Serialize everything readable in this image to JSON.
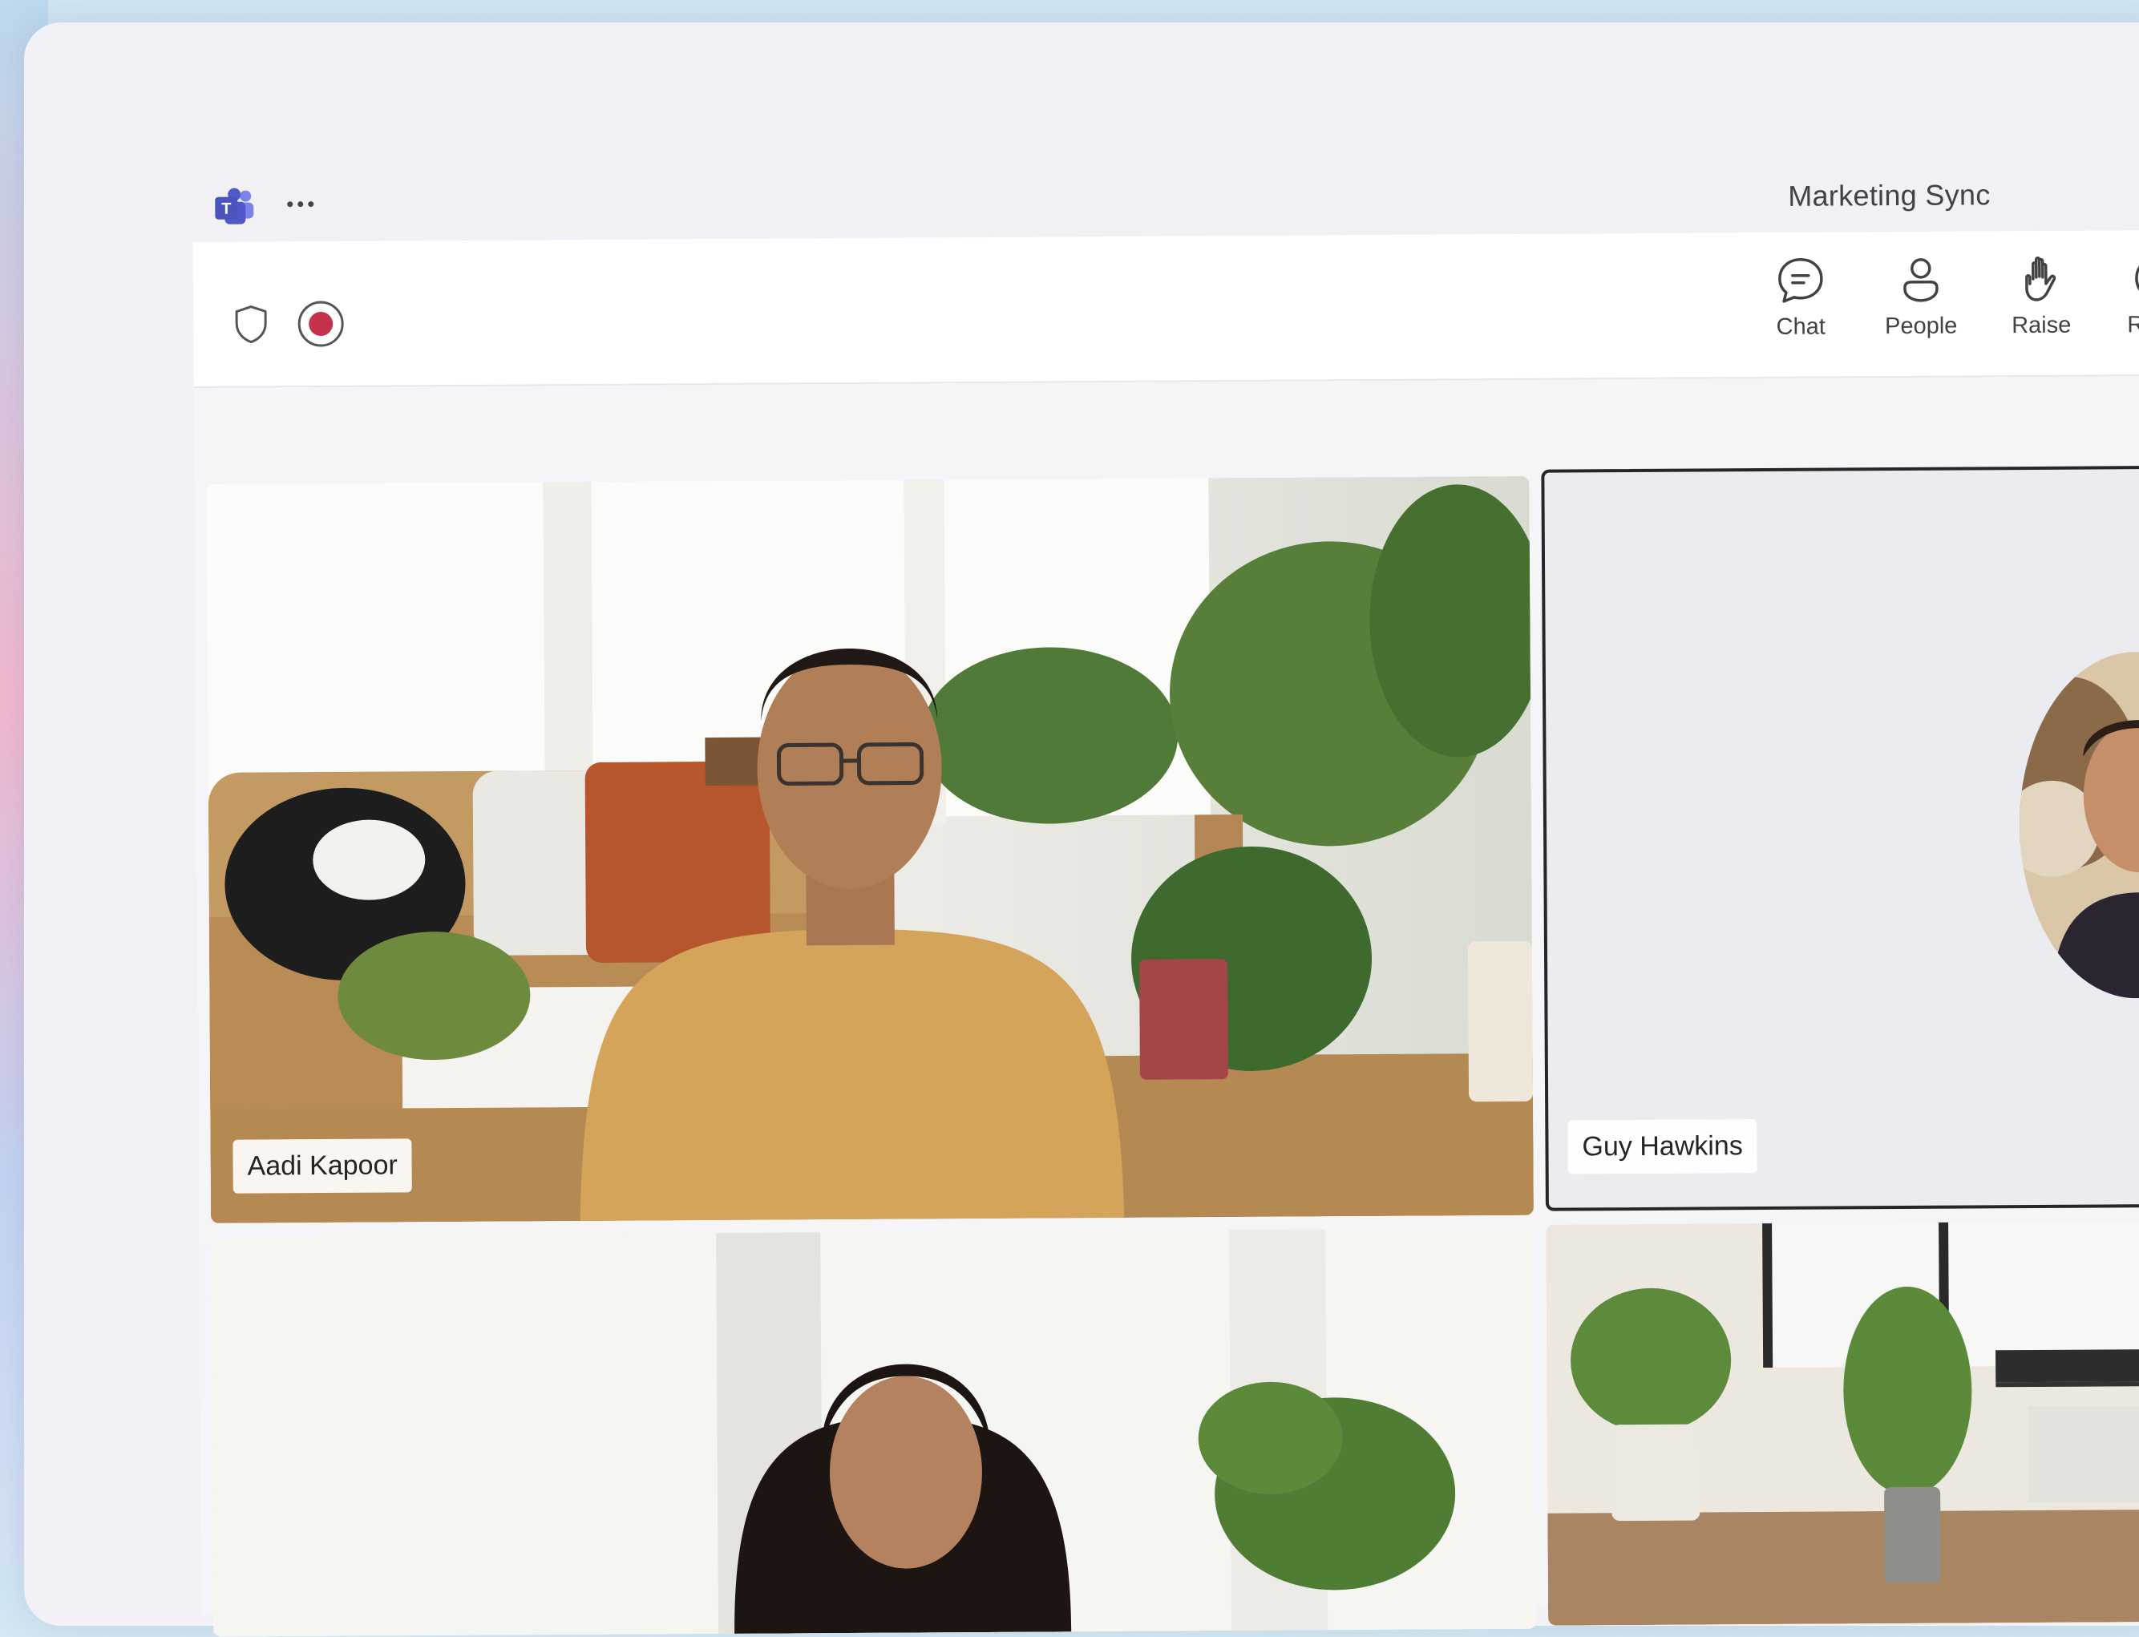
{
  "window": {
    "meeting_title": "Marketing Sync",
    "app_icon": "teams-icon",
    "more_icon": "more-dots-icon"
  },
  "toolbar": {
    "left_icons": [
      "shield-icon",
      "record-icon"
    ],
    "buttons": [
      {
        "label": "Chat",
        "icon": "chat-icon"
      },
      {
        "label": "People",
        "icon": "people-icon"
      },
      {
        "label": "Raise",
        "icon": "raise-hand-icon"
      },
      {
        "label": "React",
        "icon": "react-icon"
      }
    ]
  },
  "participants": [
    {
      "name": "Aadi Kapoor",
      "video": "on"
    },
    {
      "name": "Guy Hawkins",
      "video": "off",
      "active_speaker": true
    },
    {
      "name": "",
      "video": "on"
    },
    {
      "name": "",
      "video": "on"
    }
  ],
  "colors": {
    "teams_purple": "#5b5fc7",
    "record_red": "#c4314b",
    "active_border": "#262626"
  }
}
